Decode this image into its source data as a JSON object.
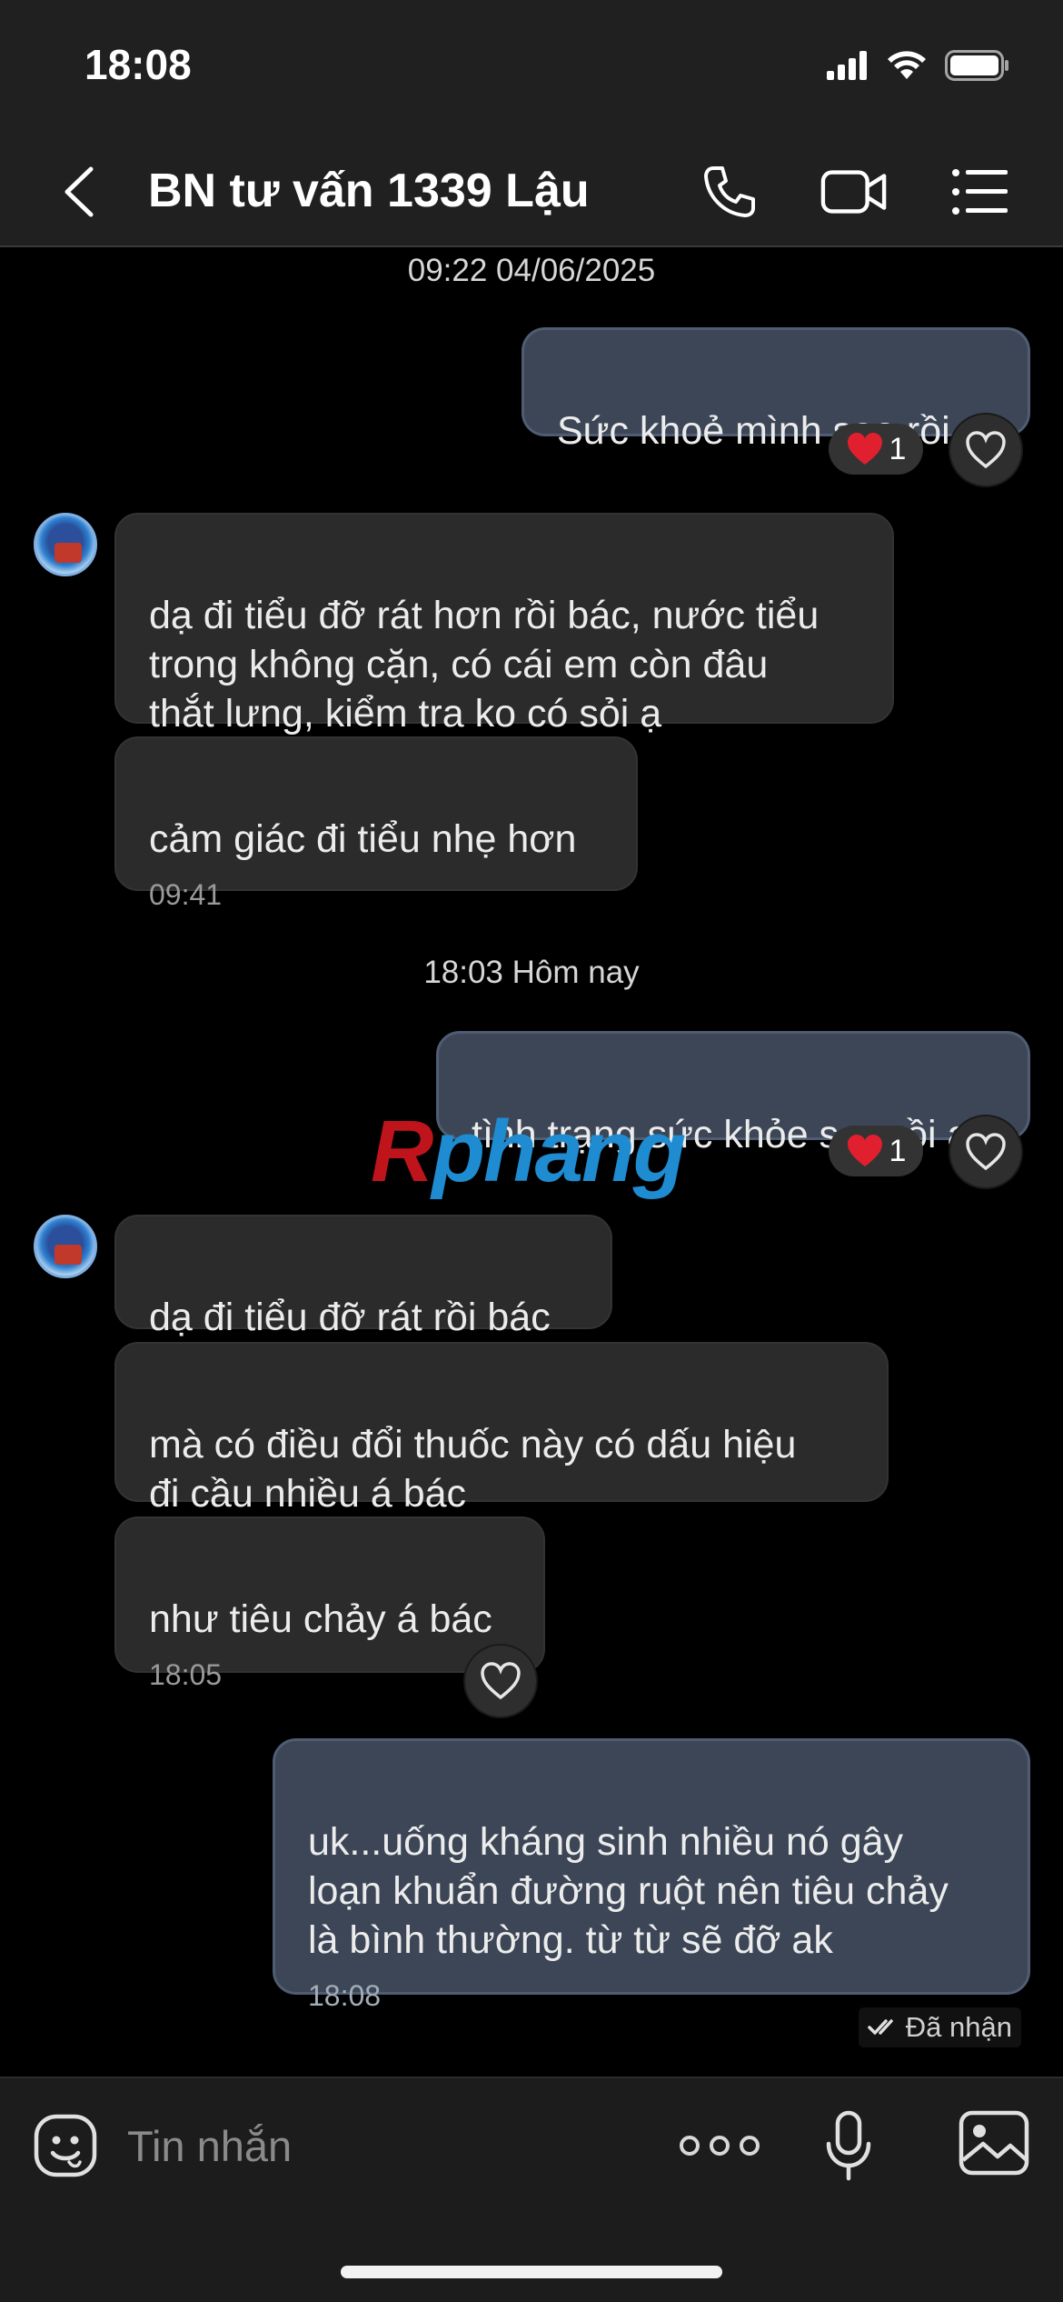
{
  "status_bar": {
    "time": "18:08"
  },
  "header": {
    "title": "BN tư vấn 1339 Lậu"
  },
  "messages": {
    "ts1": "09:22 04/06/2025",
    "m1": {
      "text": "Sức khoẻ mình sao rồi ạ",
      "reaction_count": "1"
    },
    "m2": {
      "text": "dạ đi tiểu đỡ rát hơn rồi bác, nước tiểu\ntrong không cặn, có cái em còn đâu\nthắt lưng, kiểm tra ko có sỏi ạ"
    },
    "m3": {
      "text": "cảm giác đi tiểu nhẹ hơn",
      "time": "09:41"
    },
    "ts2": "18:03 Hôm nay",
    "m4": {
      "text": "tình trạng sức khỏe sao rồi ạ",
      "reaction_count": "1"
    },
    "m5": {
      "text": "dạ đi tiểu đỡ rát rồi bác"
    },
    "m6": {
      "text": "mà có điều đổi thuốc này có dấu hiệu\nđi cầu nhiều á bác"
    },
    "m7": {
      "text": "như tiêu chảy á bác",
      "time": "18:05"
    },
    "m8": {
      "text": "uk...uống kháng sinh nhiều nó gây\nloạn khuẩn đường ruột nên tiêu chảy\nlà bình thường. từ từ sẽ đỡ ak",
      "time": "18:08"
    },
    "delivery_status": "Đã nhận"
  },
  "watermark": {
    "first": "R",
    "rest": "phang"
  },
  "input": {
    "placeholder": "Tin nhắn"
  },
  "colors": {
    "outgoing_bubble": "#3c4656",
    "incoming_bubble": "#2b2b2b",
    "reaction_heart": "#e0202e"
  }
}
